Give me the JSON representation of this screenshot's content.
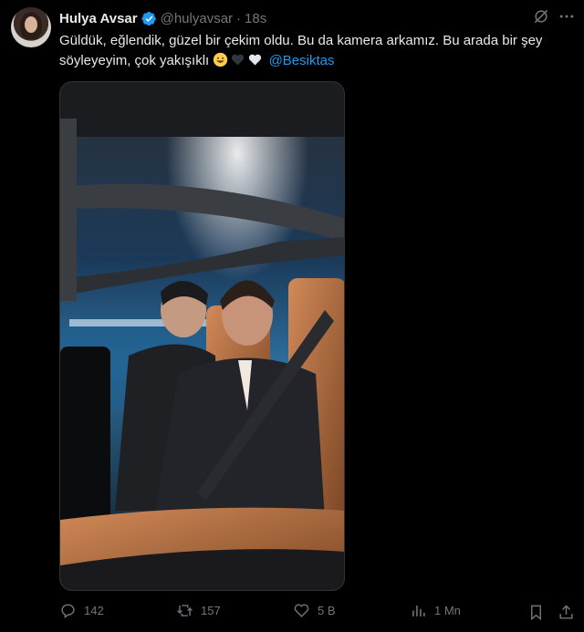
{
  "tweet": {
    "author_name": "Hulya Avsar",
    "handle": "@hulyavsar",
    "separator": "·",
    "time": "18s",
    "text_part1": "Güldük, eğlendik, güzel bir çekim oldu. Bu da kamera arkamız. Bu arada bir şey söyleyeyim, çok yakışıklı ",
    "mention": "@Besiktas",
    "emojis": [
      "grinning-face-emoji",
      "black-heart-emoji",
      "white-heart-emoji"
    ]
  },
  "media": {
    "type": "video-still",
    "description_icon": "video-frame"
  },
  "actions": {
    "replies": "142",
    "reposts": "157",
    "likes": "5 B",
    "views": "1 Mn"
  },
  "colors": {
    "background": "#000000",
    "text": "#e7e9ea",
    "muted": "#71767b",
    "link": "#1d9bf0",
    "verified": "#1d9bf0"
  }
}
